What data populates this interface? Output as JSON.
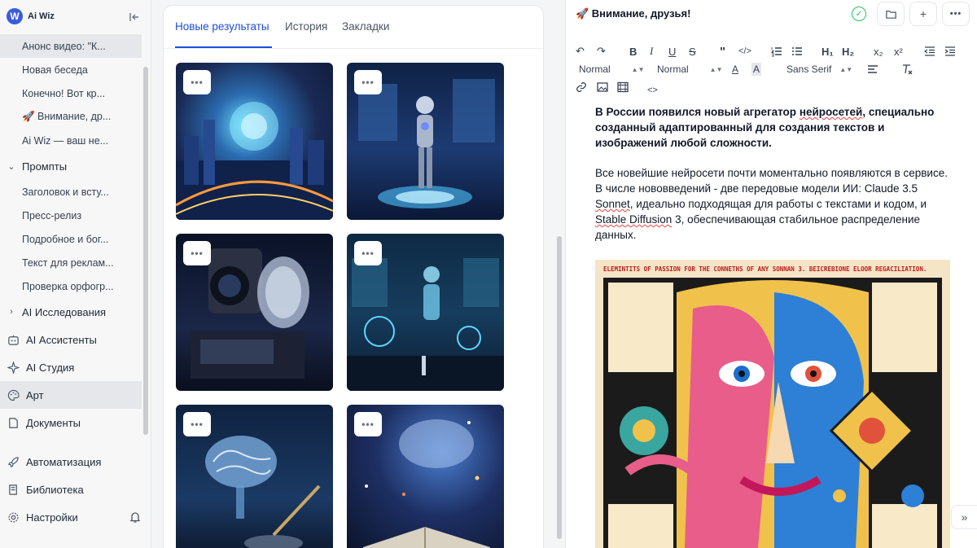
{
  "brand": {
    "name": "Ai Wiz",
    "logo_letter": "W"
  },
  "sidebar": {
    "recent": [
      "Анонс видео: \"К...",
      "Новая беседа",
      "Конечно! Вот кр...",
      "🚀 Внимание, др...",
      "Ai Wiz — ваш не..."
    ],
    "prompts_label": "Промпты",
    "prompts": [
      "Заголовок и всту...",
      "Пресс-релиз",
      "Подробное и бог...",
      "Текст для реклам...",
      "Проверка орфогр..."
    ],
    "research_label": "AI Исследования",
    "items": [
      {
        "label": "AI Ассистенты",
        "icon": "bot-icon"
      },
      {
        "label": "AI Студия",
        "icon": "sparkle-icon"
      },
      {
        "label": "Арт",
        "icon": "palette-icon"
      },
      {
        "label": "Документы",
        "icon": "document-icon"
      }
    ],
    "bottom": [
      {
        "label": "Автоматизация",
        "icon": "rocket-icon"
      },
      {
        "label": "Библиотека",
        "icon": "book-icon"
      },
      {
        "label": "Настройки",
        "icon": "gear-icon"
      }
    ]
  },
  "tabs": [
    "Новые результаты",
    "История",
    "Закладки"
  ],
  "thumbnail_menu": "•••",
  "editor": {
    "title": "🚀 Внимание, друзья!",
    "toolbar": {
      "block_format": "Normal",
      "font_size": "Normal",
      "font_family": "Sans Serif",
      "h1": "H₁",
      "h2": "H₂",
      "sub": "x₂",
      "sup": "x²",
      "code_view": "<>"
    },
    "lead_pre": "В России появился новый агрегатор ",
    "lead_word": "нейросетей",
    "lead_post": ", специально созданный адаптированный для создания текстов и изображений любой сложности.",
    "body_1": "Все новейшие нейросети почти моментально появляются в сервисе. В числе нововведений - две передовые модели ИИ: Claude 3.5 ",
    "body_sonnet": "Sonnet",
    "body_2": ", идеально подходящая для работы с текстами и кодом, и ",
    "body_stable": "Stable Diffusion",
    "body_3": " 3, обеспечивающая стабильное распределение данных.",
    "poster_headline": "ELEMINTITS OF PASSION FOR THE CONNETHS OF ANY SONNAN 3. BEICREBIONE ELOOR REGACILIATION."
  }
}
